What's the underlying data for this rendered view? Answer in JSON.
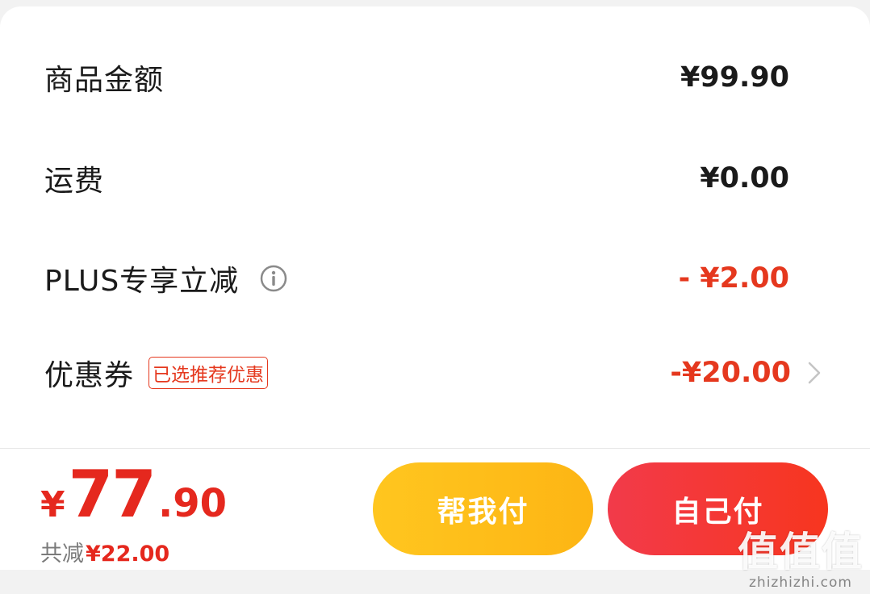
{
  "summary": {
    "rows": [
      {
        "label": "商品金额",
        "value": "¥99.90"
      },
      {
        "label": "运费",
        "value": "¥0.00"
      },
      {
        "label": "PLUS专享立减",
        "value": "- ¥2.00",
        "info_icon": "info-icon"
      },
      {
        "label": "优惠券",
        "tag": "已选推荐优惠",
        "value": "-¥20.00",
        "chevron_icon": "chevron-right-icon"
      }
    ]
  },
  "footer": {
    "total": {
      "currency": "¥",
      "integer": "77",
      "decimal": ".90"
    },
    "saving": {
      "label": "共减",
      "amount": "¥22.00"
    },
    "help_pay_button": "帮我付",
    "self_pay_button": "自己付"
  },
  "watermark": {
    "chars": "值值值",
    "url": "zhizhizhi.com"
  },
  "colors": {
    "accent_red": "#e5381e",
    "help_button": "#fdb514",
    "self_button": "#f23a4a"
  }
}
